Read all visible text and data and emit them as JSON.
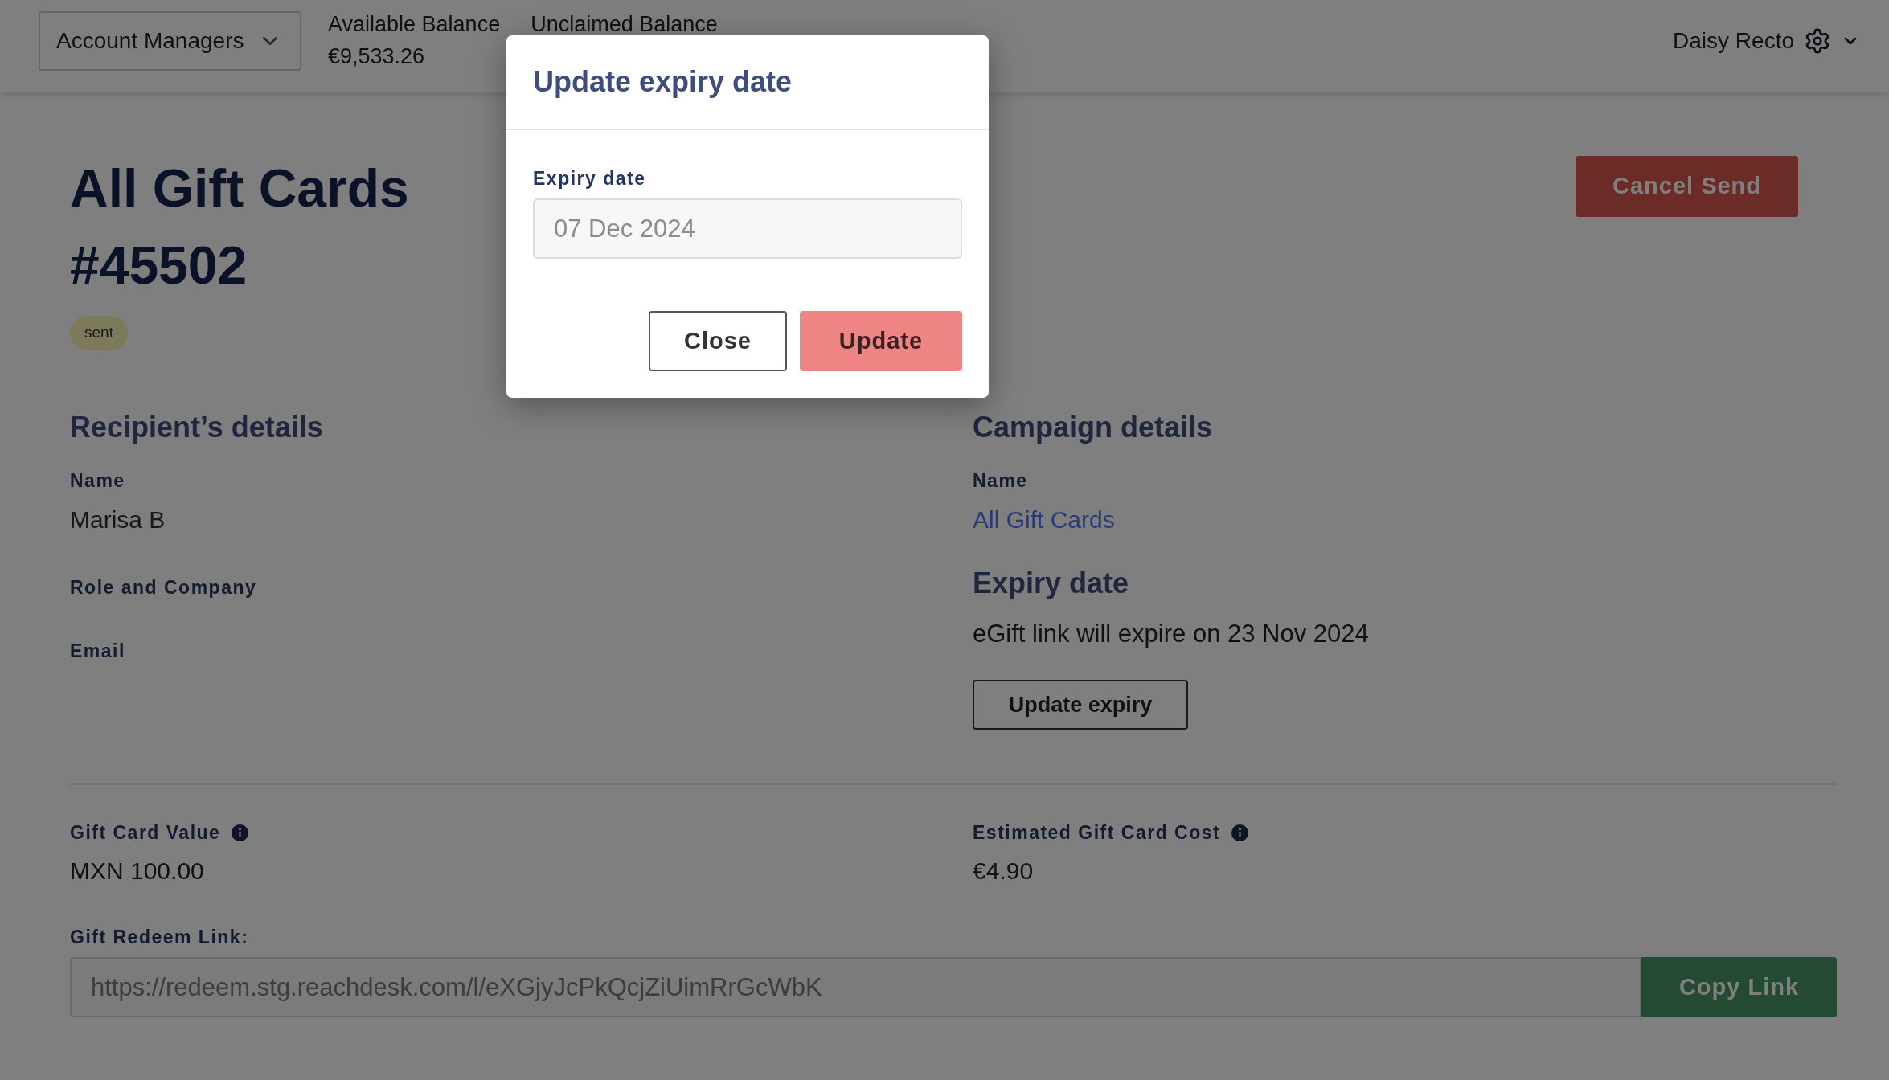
{
  "top_bar": {
    "account_dropdown": {
      "value": "Account Managers"
    },
    "balances": [
      {
        "label": "Available Balance",
        "value": "€9,533.26"
      },
      {
        "label": "Unclaimed Balance"
      }
    ],
    "user": {
      "name": "Daisy Recto"
    }
  },
  "page_header": {
    "title_lines": [
      "All Gift Cards",
      "#45502"
    ],
    "status_badge": "sent",
    "cancel_button": "Cancel Send"
  },
  "recipient_details": {
    "heading": "Recipient’s details",
    "fields": [
      {
        "label": "Name",
        "value": "Marisa B",
        "kind": "text"
      },
      {
        "label": "Role and Company"
      },
      {
        "label": "Email"
      }
    ]
  },
  "campaign_details": {
    "heading": "Campaign details",
    "fields": [
      {
        "label": "Name",
        "value": "All Gift Cards",
        "kind": "link"
      }
    ],
    "expiry": {
      "heading": "Expiry date",
      "text": "eGift link will expire on 23 Nov 2024",
      "button": "Update expiry"
    }
  },
  "costs": [
    {
      "label": "Gift Card Value",
      "value": "MXN 100.00"
    },
    {
      "label": "Estimated Gift Card Cost",
      "value": "€4.90"
    }
  ],
  "redeem_link": {
    "label": "Gift Redeem Link:",
    "value": "https://redeem.stg.reachdesk.com/l/eXGjyJcPkQcjZiUimRrGcWbK",
    "button": "Copy Link"
  },
  "modal": {
    "title": "Update expiry date",
    "field": {
      "label": "Expiry date",
      "placeholder": "07 Dec 2024"
    },
    "buttons": [
      {
        "label": "Close",
        "kind": "secondary",
        "disabled": false
      },
      {
        "label": "Update",
        "kind": "primary",
        "disabled": true
      }
    ]
  }
}
